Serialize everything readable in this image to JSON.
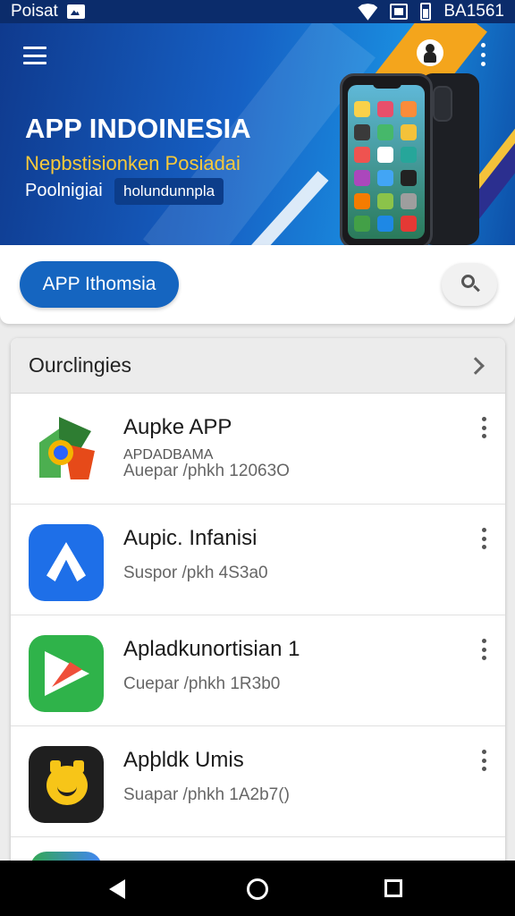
{
  "status_bar": {
    "carrier": "Poisat",
    "time": "BA1561"
  },
  "hero": {
    "title": "APP INDOINESIA",
    "subtitle": "Nepbstisionken Posiadai",
    "tagline": "Poolnigiai",
    "chip": "holundunnpla"
  },
  "search": {
    "pill_label": "APP Ithomsia"
  },
  "list": {
    "header": "Ourclingies",
    "items": [
      {
        "name": "Aupke APP",
        "subtitle": "APDADBAMA",
        "meta": "Auepar /phkh 12063O",
        "icon": "maps-style-icon"
      },
      {
        "name": "Aupic. Infanisi",
        "subtitle": "",
        "meta": "Suspor /pkh 4S3a0",
        "icon": "blue-a-icon"
      },
      {
        "name": "Apladkunortisian 1",
        "subtitle": "",
        "meta": "Cuepar /phkh 1R3b0",
        "icon": "green-play-icon"
      },
      {
        "name": "Apþldk Umis",
        "subtitle": "",
        "meta": "Suapar /phkh 1A2b7()",
        "icon": "yellow-face-icon"
      }
    ]
  },
  "colors": {
    "accent": "#1565c0",
    "status_bar": "#0b2c6b",
    "hero_yellow": "#f7c93a"
  }
}
